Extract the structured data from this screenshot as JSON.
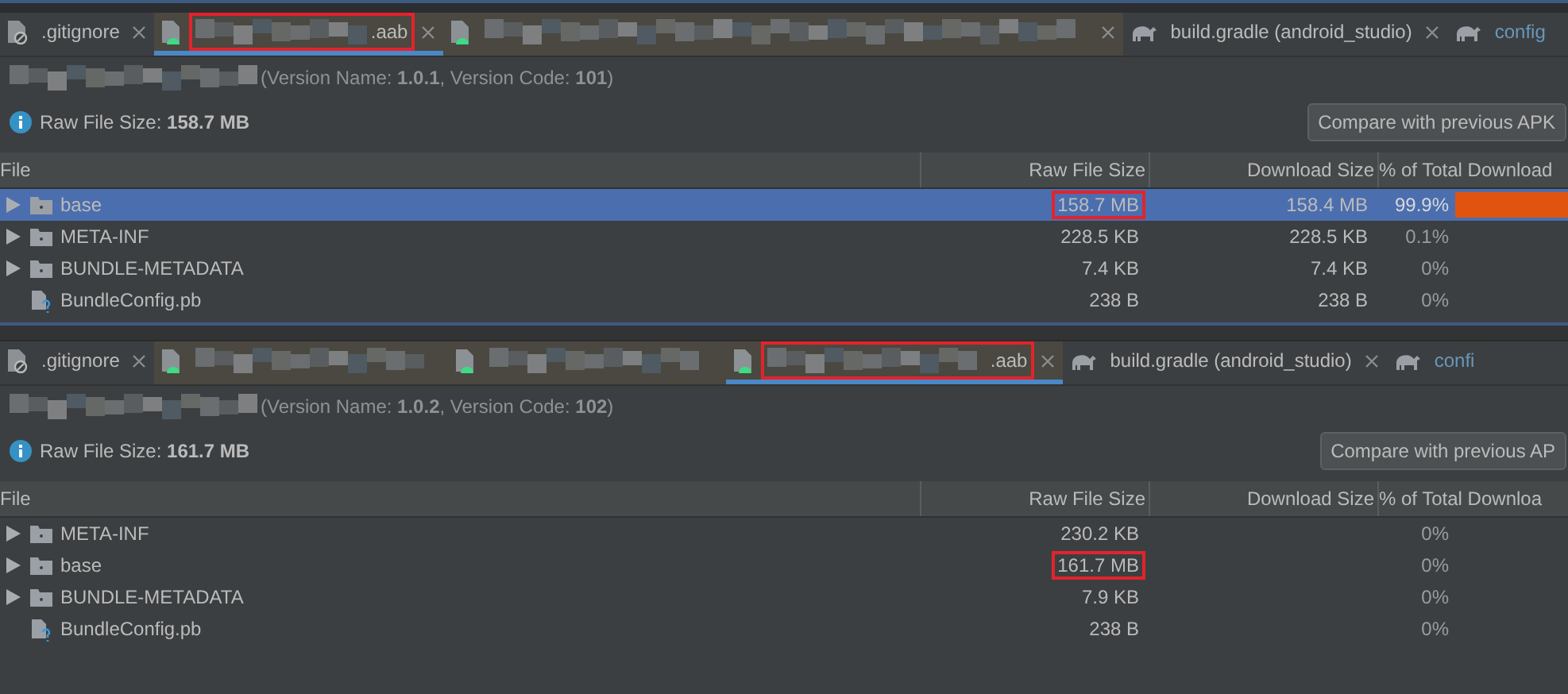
{
  "panels": [
    {
      "tabs": [
        {
          "kind": "gitignore",
          "label": ".gitignore",
          "redacted": false,
          "selected": false,
          "highlighted": false,
          "closable": true,
          "modified": false
        },
        {
          "kind": "android",
          "label": ".aab",
          "redacted": true,
          "selected": true,
          "highlighted": true,
          "closable": true,
          "modified": false
        },
        {
          "kind": "android",
          "redacted": true,
          "selected": false,
          "highlighted": false,
          "closable": true
        },
        {
          "kind": "gradle",
          "label": "build.gradle (android_studio)",
          "redacted": false,
          "selected": false,
          "highlighted": false,
          "closable": true,
          "modified": false
        },
        {
          "kind": "gradle",
          "label": "config",
          "redacted": false,
          "selected": false,
          "highlighted": false,
          "closable": false,
          "modified": true
        }
      ],
      "version_line": "(Version Name: **1.0.1**, Version Code: **101**)",
      "raw_file_size": "Raw File Size: **158.7 MB**",
      "compare_button": "Compare with previous APK",
      "columns": [
        "File",
        "Raw File Size",
        "Download Size",
        "% of Total Download"
      ],
      "rows": [
        {
          "kind": "folder",
          "name": "base",
          "raw_size": "158.7 MB",
          "raw_size_highlighted": true,
          "download_size": "158.4 MB",
          "percent": "99.9%",
          "level": 0.999,
          "selected": true
        },
        {
          "kind": "folder",
          "name": "META-INF",
          "raw_size": "228.5 KB",
          "raw_size_highlighted": false,
          "download_size": "228.5 KB",
          "percent": "0.1%",
          "selected": false
        },
        {
          "kind": "folder",
          "name": "BUNDLE-METADATA",
          "raw_size": "7.4 KB",
          "raw_size_highlighted": false,
          "download_size": "7.4 KB",
          "percent": "0%",
          "selected": false
        },
        {
          "kind": "file",
          "name": "BundleConfig.pb",
          "raw_size": "238 B",
          "raw_size_highlighted": false,
          "download_size": "238 B",
          "percent": "0%",
          "selected": false
        }
      ]
    },
    {
      "tabs": [
        {
          "kind": "gitignore",
          "label": ".gitignore",
          "redacted": false,
          "selected": false,
          "highlighted": false,
          "closable": true,
          "modified": false
        },
        {
          "kind": "android",
          "redacted": true,
          "selected": false,
          "highlighted": false,
          "closable": false
        },
        {
          "kind": "android",
          "redacted": true,
          "selected": false,
          "highlighted": false,
          "closable": false
        },
        {
          "kind": "android",
          "label": ".aab",
          "redacted": true,
          "selected": true,
          "highlighted": true,
          "closable": true,
          "modified": false
        },
        {
          "kind": "gradle",
          "label": "build.gradle (android_studio)",
          "redacted": false,
          "selected": false,
          "highlighted": false,
          "closable": true,
          "modified": false
        },
        {
          "kind": "gradle",
          "label": "confi",
          "redacted": false,
          "selected": false,
          "highlighted": false,
          "closable": false,
          "modified": true
        }
      ],
      "version_line": "(Version Name: **1.0.2**, Version Code: **102**)",
      "raw_file_size": "Raw File Size: **161.7 MB**",
      "compare_button": "Compare with previous AP",
      "columns": [
        "File",
        "Raw File Size",
        "Download Size",
        "% of Total Downloa"
      ],
      "rows": [
        {
          "kind": "folder",
          "name": "META-INF",
          "raw_size": "230.2 KB",
          "raw_size_highlighted": false,
          "percent": "0%",
          "selected": false
        },
        {
          "kind": "folder",
          "name": "base",
          "raw_size": "161.7 MB",
          "raw_size_highlighted": true,
          "percent": "0%",
          "selected": false
        },
        {
          "kind": "folder",
          "name": "BUNDLE-METADATA",
          "raw_size": "7.9 KB",
          "raw_size_highlighted": false,
          "percent": "0%",
          "selected": false
        },
        {
          "kind": "file",
          "name": "BundleConfig.pb",
          "raw_size": "238 B",
          "raw_size_highlighted": false,
          "percent": "0%",
          "selected": false
        }
      ]
    }
  ]
}
